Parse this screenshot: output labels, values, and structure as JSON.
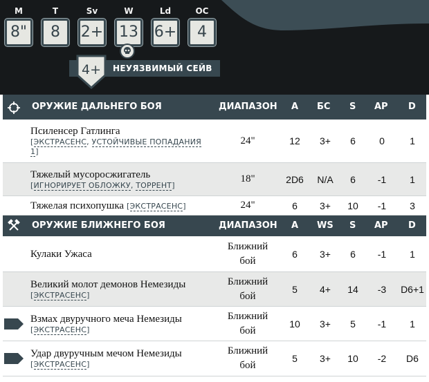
{
  "stats": [
    {
      "label": "M",
      "value": "8\""
    },
    {
      "label": "T",
      "value": "8"
    },
    {
      "label": "Sv",
      "value": "2+"
    },
    {
      "label": "W",
      "value": "13"
    },
    {
      "label": "Ld",
      "value": "6+"
    },
    {
      "label": "OC",
      "value": "4"
    }
  ],
  "invuln": {
    "value": "4+",
    "label": "НЕУЯЗВИМЫЙ СЕЙВ"
  },
  "ranged": {
    "headers": {
      "title": "ОРУЖИЕ ДАЛЬНЕГО БОЯ",
      "range": "ДИАПАЗОН",
      "a": "A",
      "skill": "БС",
      "s": "S",
      "ap": "AP",
      "d": "D"
    },
    "rows": [
      {
        "name": "Псиленсер Гатлинга",
        "kw_open": "[",
        "kw1": "ЭКСТРАСЕНС",
        "sep": ", ",
        "kw2": "УСТОЙЧИВЫЕ ПОПАДАНИЯ",
        "kw2b": "1",
        "kw_close": "]",
        "range": "24\"",
        "a": "12",
        "skill": "3+",
        "s": "6",
        "ap": "0",
        "d": "1"
      },
      {
        "name": "Тяжелый мусоросжигатель",
        "kw_open": "[",
        "kw1": "ИГНОРИРУЕТ ОБЛОЖКУ",
        "sep": ", ",
        "kw2": "ТОРРЕНТ",
        "kw_close": "]",
        "range": "18\"",
        "a": "2D6",
        "skill": "N/A",
        "s": "6",
        "ap": "-1",
        "d": "1"
      },
      {
        "name": "Тяжелая психопушка",
        "kw_open": "[",
        "kw1": "ЭКСТРАСЕНС",
        "kw_close": "]",
        "range": "24\"",
        "a": "6",
        "skill": "3+",
        "s": "10",
        "ap": "-1",
        "d": "3"
      }
    ]
  },
  "melee": {
    "headers": {
      "title": "ОРУЖИЕ БЛИЖНЕГО БОЯ",
      "range": "ДИАПАЗОН",
      "a": "A",
      "skill": "WS",
      "s": "S",
      "ap": "AP",
      "d": "D"
    },
    "rows": [
      {
        "name": "Кулаки Ужаса",
        "range1": "Ближний",
        "range2": "бой",
        "a": "6",
        "skill": "3+",
        "s": "6",
        "ap": "-1",
        "d": "1"
      },
      {
        "name": "Великий молот демонов Немезиды",
        "kw_open": "[",
        "kw1": "ЭКСТРАСЕНС",
        "kw_close": "]",
        "range1": "Ближний",
        "range2": "бой",
        "a": "5",
        "skill": "4+",
        "s": "14",
        "ap": "-3",
        "d": "D6+1"
      },
      {
        "name": "Взмах двуручного меча Немезиды",
        "kw_open": "[",
        "kw1": "ЭКСТРАСЕНС",
        "kw_close": "]",
        "range1": "Ближний",
        "range2": "бой",
        "a": "10",
        "skill": "3+",
        "s": "5",
        "ap": "-1",
        "d": "1"
      },
      {
        "name": "Удар двуручным мечом Немезиды",
        "kw_open": "[",
        "kw1": "ЭКСТРАСЕНС",
        "kw_close": "]",
        "range1": "Ближний",
        "range2": "бой",
        "a": "5",
        "skill": "3+",
        "s": "10",
        "ap": "-2",
        "d": "D6"
      }
    ]
  },
  "colors": {
    "header_bg": "#37474f",
    "dark_bg": "#16191b",
    "stat_box": "#e6e7e2",
    "alt_row": "#e8e9e8"
  },
  "icons": {
    "ranged": "crosshair-icon",
    "melee": "crossed-hammers-icon",
    "skull": "skull-icon",
    "profile_marker": "arrow-marker-icon"
  }
}
